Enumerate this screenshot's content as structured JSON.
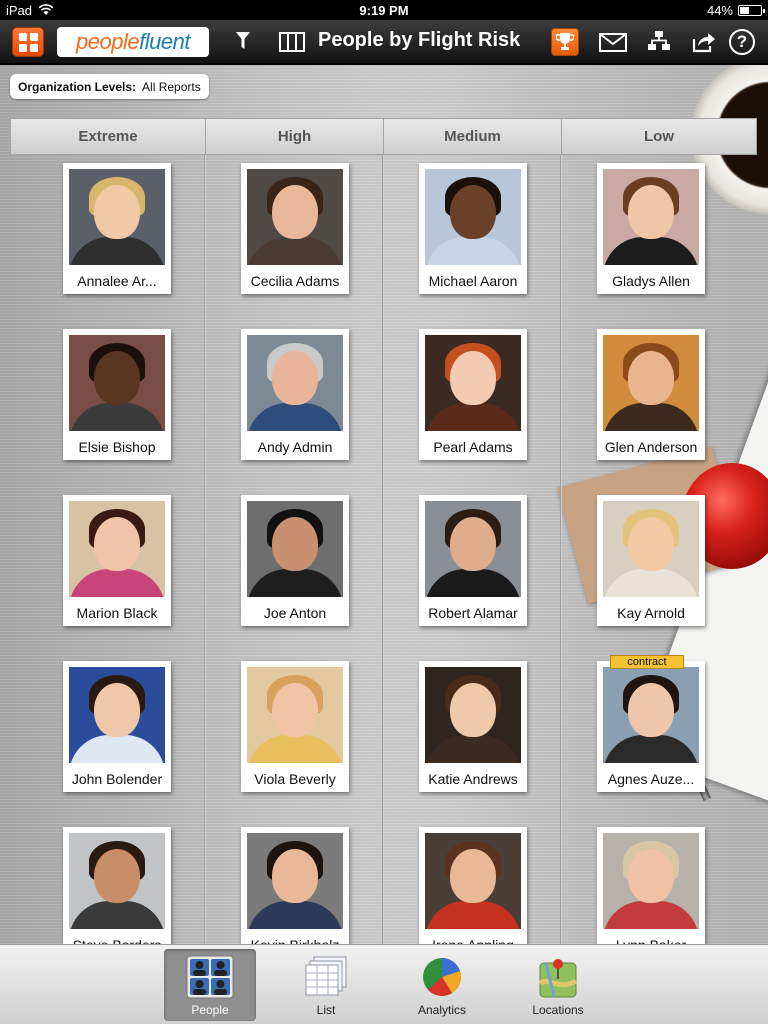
{
  "status": {
    "device": "iPad",
    "time": "9:19 PM",
    "battery": "44%",
    "battery_level": 0.44
  },
  "nav": {
    "logo_a": "people",
    "logo_b": "fluent",
    "title": "People by Flight Risk",
    "help": "?"
  },
  "org": {
    "label": "Organization Levels:",
    "value": "All Reports"
  },
  "columns": [
    {
      "label": "Extreme"
    },
    {
      "label": "High"
    },
    {
      "label": "Medium"
    },
    {
      "label": "Low"
    }
  ],
  "people": [
    [
      {
        "name": "Annalee Ar...",
        "skin": "#f1c9a6",
        "hair": "#d9b76a",
        "shirt": "#2f2f2f",
        "bg": "#5b5f6a"
      },
      {
        "name": "Elsie Bishop",
        "skin": "#5a3522",
        "hair": "#1b110b",
        "shirt": "#3b3b3b",
        "bg": "#7a4e46"
      },
      {
        "name": "Marion Black",
        "skin": "#efc4a8",
        "hair": "#3a1a14",
        "shirt": "#c8457a",
        "bg": "#d7c2a5"
      },
      {
        "name": "John Bolender",
        "skin": "#f0c7a9",
        "hair": "#2a1b12",
        "shirt": "#dfe7f2",
        "bg": "#2b4c9a"
      },
      {
        "name": "Steve Borders",
        "skin": "#c98e68",
        "hair": "#2a1b12",
        "shirt": "#3a3a3a",
        "bg": "#c0c4c7"
      }
    ],
    [
      {
        "name": "Cecilia Adams",
        "skin": "#e9b79a",
        "hair": "#3a2418",
        "shirt": "#4a3a33",
        "bg": "#4f4a46"
      },
      {
        "name": "Andy Admin",
        "skin": "#e8b59a",
        "hair": "#c9c9c9",
        "shirt": "#2f4d7a",
        "bg": "#7d8a96"
      },
      {
        "name": "Joe Anton",
        "skin": "#c89070",
        "hair": "#111111",
        "shirt": "#1e1e1e",
        "bg": "#6e6e6e"
      },
      {
        "name": "Viola Beverly",
        "skin": "#f0c4a4",
        "hair": "#d8a25c",
        "shirt": "#e9c060",
        "bg": "#e3c9a0"
      },
      {
        "name": "Kevin Birkholz",
        "skin": "#e8b898",
        "hair": "#1d1410",
        "shirt": "#2b3a59",
        "bg": "#7b7b7b"
      }
    ],
    [
      {
        "name": "Michael Aaron",
        "skin": "#6b402a",
        "hair": "#1a100a",
        "shirt": "#c9d5e6",
        "bg": "#b8c6da"
      },
      {
        "name": "Pearl Adams",
        "skin": "#f3cbb2",
        "hair": "#c4501f",
        "shirt": "#5a2a1a",
        "bg": "#3a2a22"
      },
      {
        "name": "Robert Alamar",
        "skin": "#e0ad8c",
        "hair": "#2b1d13",
        "shirt": "#1a1a1a",
        "bg": "#8a8f95"
      },
      {
        "name": "Katie Andrews",
        "skin": "#f0c8aa",
        "hair": "#4a2a18",
        "shirt": "#3a2a22",
        "bg": "#2e2420"
      },
      {
        "name": "Irene Appling",
        "skin": "#e9b896",
        "hair": "#5a321e",
        "shirt": "#c4311e",
        "bg": "#4a3f36"
      }
    ],
    [
      {
        "name": "Gladys Allen",
        "skin": "#f1c6a6",
        "hair": "#6b3e22",
        "shirt": "#1c1c1c",
        "bg": "#c9a9a3",
        "badge": ""
      },
      {
        "name": "Glen Anderson",
        "skin": "#e9b58f",
        "hair": "#8a4a1c",
        "shirt": "#3c2a1e",
        "bg": "#d08b3c",
        "badge": ""
      },
      {
        "name": "Kay Arnold",
        "skin": "#f3c8a4",
        "hair": "#e3c27a",
        "shirt": "#e9e2d6",
        "bg": "#d9cfc0",
        "badge": ""
      },
      {
        "name": "Agnes Auze...",
        "skin": "#f0c6ab",
        "hair": "#1e1410",
        "shirt": "#2a2a2a",
        "bg": "#8aa0b2",
        "badge": "contract"
      },
      {
        "name": "Lynn Baker",
        "skin": "#f1c2a6",
        "hair": "#d9c7a4",
        "shirt": "#c23b3b",
        "bg": "#b6b1a9",
        "badge": ""
      }
    ]
  ],
  "tabs": [
    {
      "label": "People",
      "icon": "people-icon",
      "active": true
    },
    {
      "label": "List",
      "icon": "list-icon",
      "active": false
    },
    {
      "label": "Analytics",
      "icon": "pie-chart-icon",
      "active": false
    },
    {
      "label": "Locations",
      "icon": "map-pin-icon",
      "active": false
    }
  ]
}
